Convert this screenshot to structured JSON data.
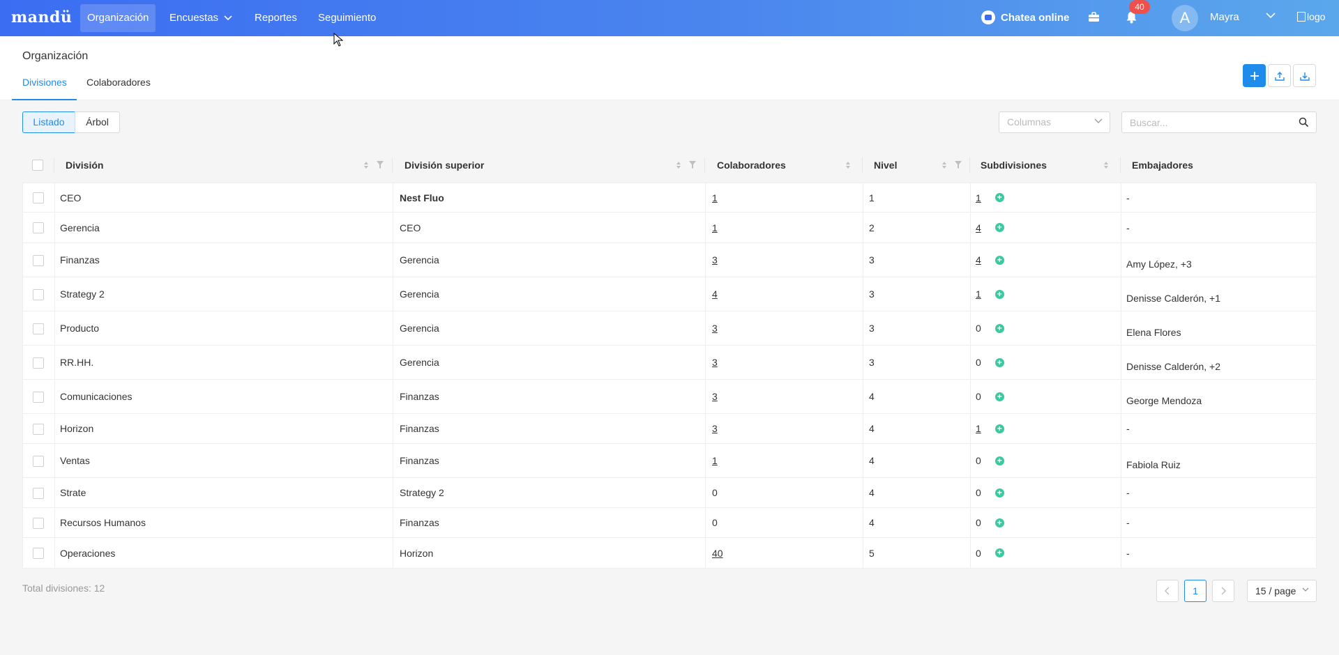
{
  "app": {
    "logo": "mandü",
    "logo_alt": "logo"
  },
  "nav": [
    {
      "label": "Organización",
      "active": true
    },
    {
      "label": "Encuestas",
      "has_dropdown": true
    },
    {
      "label": "Reportes"
    },
    {
      "label": "Seguimiento"
    }
  ],
  "topbar": {
    "chat_label": "Chatea online",
    "notifications_count": "40",
    "user_initial": "A",
    "user_name": "Mayra"
  },
  "page": {
    "title": "Organización",
    "tabs": [
      {
        "label": "Divisiones",
        "active": true
      },
      {
        "label": "Colaboradores"
      }
    ],
    "action_icons": [
      "plus-icon",
      "upload-icon",
      "download-icon"
    ]
  },
  "toolbar": {
    "view_modes": [
      {
        "label": "Listado",
        "active": true
      },
      {
        "label": "Árbol"
      }
    ],
    "columns_placeholder": "Columnas",
    "search_placeholder": "Buscar..."
  },
  "table": {
    "headers": [
      "División",
      "División superior",
      "Colaboradores",
      "Nivel",
      "Subdivisiones",
      "Embajadores"
    ],
    "rows": [
      {
        "division": "CEO",
        "superior": "Nest Fluo",
        "superior_bold": true,
        "colaboradores": "1",
        "colab_link": true,
        "nivel": "1",
        "subdivisiones": "1",
        "sub_link": true,
        "embajadores": "-"
      },
      {
        "division": "Gerencia",
        "superior": "CEO",
        "colaboradores": "1",
        "colab_link": true,
        "nivel": "2",
        "subdivisiones": "4",
        "sub_link": true,
        "embajadores": "-"
      },
      {
        "division": "Finanzas",
        "superior": "Gerencia",
        "colaboradores": "3",
        "colab_link": true,
        "nivel": "3",
        "subdivisiones": "4",
        "sub_link": true,
        "embajadores": "Amy López, +3"
      },
      {
        "division": "Strategy 2",
        "superior": "Gerencia",
        "colaboradores": "4",
        "colab_link": true,
        "nivel": "3",
        "subdivisiones": "1",
        "sub_link": true,
        "embajadores": "Denisse Calderón, +1"
      },
      {
        "division": "Producto",
        "superior": "Gerencia",
        "colaboradores": "3",
        "colab_link": true,
        "nivel": "3",
        "subdivisiones": "0",
        "embajadores": "Elena Flores"
      },
      {
        "division": "RR.HH.",
        "superior": "Gerencia",
        "colaboradores": "3",
        "colab_link": true,
        "nivel": "3",
        "subdivisiones": "0",
        "embajadores": "Denisse Calderón, +2"
      },
      {
        "division": "Comunicaciones",
        "superior": "Finanzas",
        "colaboradores": "3",
        "colab_link": true,
        "nivel": "4",
        "subdivisiones": "0",
        "embajadores": "George Mendoza"
      },
      {
        "division": "Horizon",
        "superior": "Finanzas",
        "colaboradores": "3",
        "colab_link": true,
        "nivel": "4",
        "subdivisiones": "1",
        "sub_link": true,
        "embajadores": "-"
      },
      {
        "division": "Ventas",
        "superior": "Finanzas",
        "colaboradores": "1",
        "colab_link": true,
        "nivel": "4",
        "subdivisiones": "0",
        "embajadores": "Fabiola Ruiz"
      },
      {
        "division": "Strate",
        "superior": "Strategy 2",
        "colaboradores": "0",
        "nivel": "4",
        "subdivisiones": "0",
        "embajadores": "-"
      },
      {
        "division": "Recursos Humanos",
        "superior": "Finanzas",
        "colaboradores": "0",
        "nivel": "4",
        "subdivisiones": "0",
        "embajadores": "-"
      },
      {
        "division": "Operaciones",
        "superior": "Horizon",
        "colaboradores": "40",
        "colab_link": true,
        "nivel": "5",
        "subdivisiones": "0",
        "embajadores": "-"
      }
    ]
  },
  "footer": {
    "total": "Total divisiones: 12",
    "current_page": "1",
    "page_size": "15 / page"
  },
  "colors": {
    "primary": "#1f8ceb",
    "topbar_start": "#3b6df2",
    "topbar_end": "#5ba7ec",
    "add_icon": "#3cc9a0",
    "badge": "#f0504c"
  }
}
